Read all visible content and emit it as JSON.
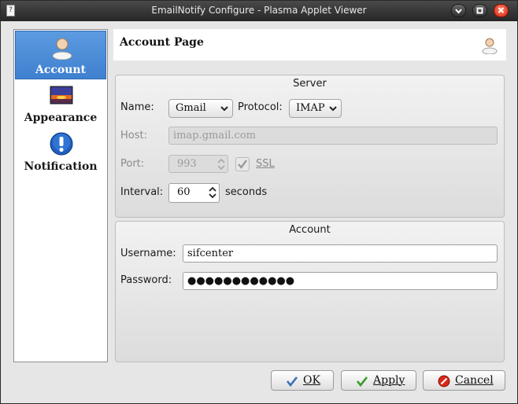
{
  "window": {
    "title": "EmailNotify Configure - Plasma Applet Viewer"
  },
  "sidebar": {
    "items": [
      {
        "label": "Account",
        "icon": "user-icon",
        "active": true
      },
      {
        "label": "Appearance",
        "icon": "wallpaper-icon",
        "active": false
      },
      {
        "label": "Notification",
        "icon": "info-icon",
        "active": false
      }
    ]
  },
  "page": {
    "title": "Account Page",
    "icon": "user-icon"
  },
  "server": {
    "title": "Server",
    "name_label": "Name:",
    "name_value": "Gmail",
    "protocol_label": "Protocol:",
    "protocol_value": "IMAP",
    "host_label": "Host:",
    "host_value": "imap.gmail.com",
    "port_label": "Port:",
    "port_value": "993",
    "ssl_label": "SSL",
    "ssl_checked": true,
    "interval_label": "Interval:",
    "interval_value": "60",
    "interval_unit": "seconds"
  },
  "account": {
    "title": "Account",
    "username_label": "Username:",
    "username_value": "sifcenter",
    "password_label": "Password:",
    "password_value": "●●●●●●●●●●●●"
  },
  "buttons": {
    "ok": "OK",
    "apply": "Apply",
    "cancel": "Cancel"
  },
  "colors": {
    "accent": "#4a8ad8",
    "close": "#d11c0c",
    "titlebar": "#2e2e2e"
  }
}
